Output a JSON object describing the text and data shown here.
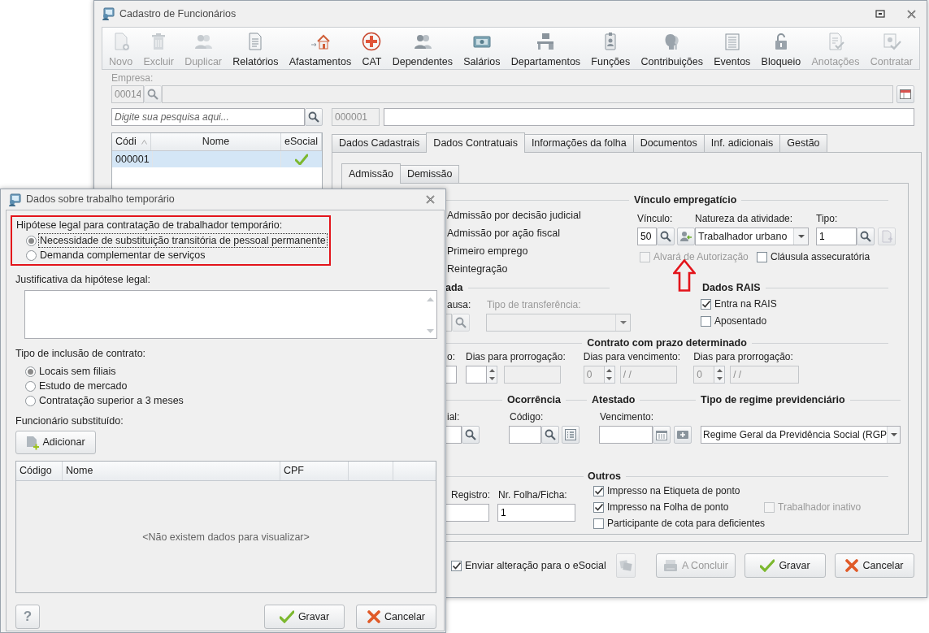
{
  "main_window": {
    "title": "Cadastro de Funcionários",
    "toolbar": [
      {
        "label": "Novo",
        "disabled": true
      },
      {
        "label": "Excluir",
        "disabled": true
      },
      {
        "label": "Duplicar",
        "disabled": true
      },
      {
        "label": "Relatórios",
        "disabled": false
      },
      {
        "label": "Afastamentos",
        "disabled": false
      },
      {
        "label": "CAT",
        "disabled": false
      },
      {
        "label": "Dependentes",
        "disabled": false
      },
      {
        "label": "Salários",
        "disabled": false
      },
      {
        "label": "Departamentos",
        "disabled": false
      },
      {
        "label": "Funções",
        "disabled": false
      },
      {
        "label": "Contribuições",
        "disabled": false
      },
      {
        "label": "Eventos",
        "disabled": false
      },
      {
        "label": "Bloqueio",
        "disabled": false
      },
      {
        "label": "Anotações",
        "disabled": true
      },
      {
        "label": "Contratar",
        "disabled": true
      }
    ],
    "company": {
      "label": "Empresa:",
      "code": "00014"
    },
    "search": {
      "placeholder": "Digite sua pesquisa aqui..."
    },
    "record": {
      "code": "000001"
    },
    "employee_list": {
      "columns": [
        "Códi",
        "Nome",
        "eSocial"
      ],
      "rows": [
        {
          "code": "000001",
          "esocial": true,
          "selected": true
        }
      ]
    },
    "tabs": [
      {
        "label": "Dados Cadastrais",
        "selected": false
      },
      {
        "label": "Dados Contratuais",
        "selected": true
      },
      {
        "label": "Informações da folha",
        "selected": false
      },
      {
        "label": "Documentos",
        "selected": false
      },
      {
        "label": "Inf. adicionais",
        "selected": false
      },
      {
        "label": "Gestão",
        "selected": false
      }
    ],
    "subtabs": [
      {
        "label": "Admissão",
        "selected": true
      },
      {
        "label": "Demissão",
        "selected": false
      }
    ],
    "admission_options": [
      "Admissão por decisão judicial",
      "Admissão por ação fiscal",
      "Primeiro emprego",
      "Reintegração"
    ],
    "employment": {
      "title": "Vínculo empregatício",
      "bond_label": "Vínculo:",
      "bond_value": "50",
      "nature_label": "Natureza da atividade:",
      "nature_value": "Trabalhador urbano",
      "type_label": "Tipo:",
      "type_value": "1",
      "options": [
        {
          "label": "Alvará de Autorização",
          "checked": false,
          "disabled": true
        },
        {
          "label": "Cláusula assecuratória",
          "checked": false,
          "disabled": false
        }
      ]
    },
    "highlight_arrow": true,
    "transfer": {
      "title": "ada",
      "cause_label": "ausa:",
      "type_label": "Tipo de transferência:",
      "disabled": true
    },
    "rais": {
      "title": "Dados RAIS",
      "options": [
        {
          "label": "Entra na RAIS",
          "checked": true
        },
        {
          "label": "Aposentado",
          "checked": false
        }
      ]
    },
    "fixed_term": {
      "title": "Contrato com prazo determinado",
      "groups": [
        {
          "label": "o:",
          "kind": "cut"
        },
        {
          "label": "Dias para prorrogação:",
          "kind": "spin",
          "disabled": false,
          "date_disabled": true
        },
        {
          "label": "Dias para vencimento:",
          "kind": "spin",
          "spin_value": "0",
          "date_value": "/ /",
          "disabled": true,
          "date_disabled": true
        },
        {
          "label": "Dias para prorrogação:",
          "kind": "spin",
          "spin_value": "0",
          "date_value": "/ /",
          "disabled": true,
          "date_disabled": true
        }
      ]
    },
    "leave": {
      "cut_label": "ial:",
      "occurrence_title": "Ocorrência",
      "code_label": "Código:",
      "certificate_title": "Atestado",
      "due_label": "Vencimento:",
      "regime_title": "Tipo de regime previdenciário",
      "regime_value": "Regime Geral da Previdência Social (RGP"
    },
    "registry": {
      "registro_label": "Registro:",
      "sheet_label": "Nr. Folha/Ficha:",
      "sheet_value": "1"
    },
    "others": {
      "title": "Outros",
      "options": [
        {
          "label": "Impresso na Etiqueta de ponto",
          "checked": true,
          "disabled": false
        },
        {
          "label": "Impresso na Folha de ponto",
          "checked": true,
          "disabled": false
        },
        {
          "label": "Trabalhador inativo",
          "checked": false,
          "disabled": true
        },
        {
          "label": "Participante de cota para deficientes",
          "checked": false,
          "disabled": false
        }
      ]
    },
    "esocial_option": {
      "label": "Enviar alteração para o eSocial",
      "checked": true
    },
    "sync_button": {
      "disabled": true
    },
    "buttons": [
      {
        "label": "A Concluir",
        "kind": "conclude",
        "disabled": true
      },
      {
        "label": "Gravar",
        "kind": "save",
        "disabled": false
      },
      {
        "label": "Cancelar",
        "kind": "cancel",
        "disabled": false
      }
    ]
  },
  "dialog": {
    "title": "Dados sobre trabalho temporário",
    "hypothesis": {
      "label": "Hipótese legal para contratação de trabalhador temporário:",
      "highlighted": true,
      "options": [
        {
          "label": "Necessidade de substituição transitória de pessoal permanente",
          "selected": true
        },
        {
          "label": "Demanda complementar de serviços",
          "selected": false
        }
      ]
    },
    "justification": {
      "label": "Justificativa da hipótese legal:"
    },
    "inclusion": {
      "label": "Tipo de inclusão de contrato:",
      "options": [
        {
          "label": "Locais sem filiais",
          "selected": true
        },
        {
          "label": "Estudo de mercado",
          "selected": false
        },
        {
          "label": "Contratação superior a 3 meses",
          "selected": false
        }
      ]
    },
    "replaced": {
      "label": "Funcionário substituído:",
      "add_button": "Adicionar",
      "columns": [
        "Código",
        "Nome",
        "CPF"
      ],
      "empty_message": "<Não existem dados para visualizar>"
    },
    "help_button": "?",
    "buttons": [
      {
        "label": "Gravar",
        "kind": "save"
      },
      {
        "label": "Cancelar",
        "kind": "cancel"
      }
    ]
  }
}
